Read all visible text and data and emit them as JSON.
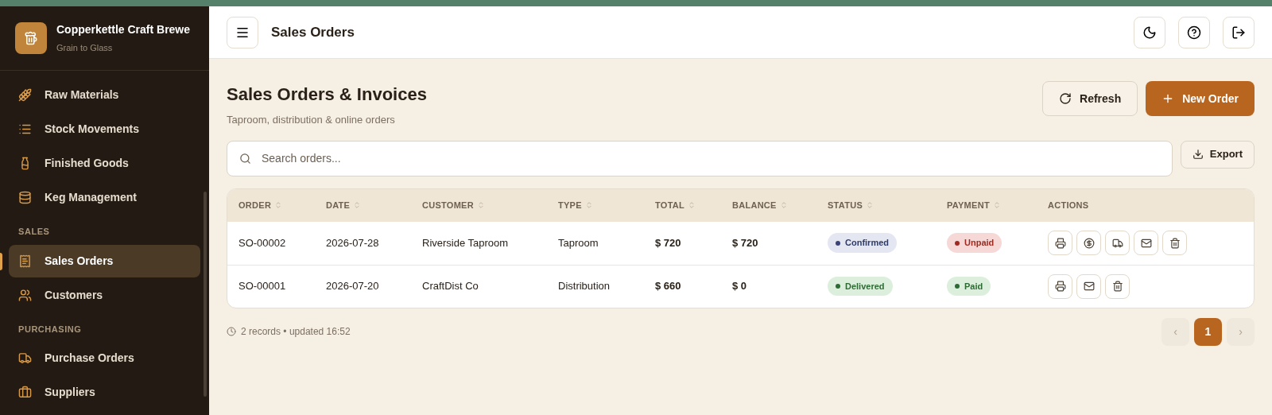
{
  "brand": {
    "name": "Copperkettle Craft Brewe",
    "tagline": "Grain to Glass"
  },
  "sidebar": {
    "groups": [
      {
        "items": [
          {
            "label": "Raw Materials",
            "kind": "wheat",
            "selected": false
          },
          {
            "label": "Stock Movements",
            "kind": "list",
            "selected": false
          },
          {
            "label": "Finished Goods",
            "kind": "bottle",
            "selected": false
          },
          {
            "label": "Keg Management",
            "kind": "keg",
            "selected": false
          }
        ]
      },
      {
        "heading": "SALES",
        "items": [
          {
            "label": "Sales Orders",
            "kind": "receipt",
            "selected": true
          },
          {
            "label": "Customers",
            "kind": "users",
            "selected": false
          }
        ]
      },
      {
        "heading": "PURCHASING",
        "items": [
          {
            "label": "Purchase Orders",
            "kind": "truck",
            "selected": false
          },
          {
            "label": "Suppliers",
            "kind": "briefcase",
            "selected": false
          }
        ]
      }
    ]
  },
  "header": {
    "title": "Sales Orders"
  },
  "page": {
    "title": "Sales Orders & Invoices",
    "subtitle": "Taproom, distribution & online orders",
    "buttons": [
      {
        "label": "Refresh",
        "kind": "refresh"
      },
      {
        "label": "New Order",
        "kind": "new"
      }
    ]
  },
  "search": {
    "placeholder": "Search orders..."
  },
  "export": {
    "label": "Export"
  },
  "table": {
    "columns": [
      {
        "label": "ORDER",
        "sortable": true
      },
      {
        "label": "DATE",
        "sortable": true
      },
      {
        "label": "CUSTOMER",
        "sortable": true
      },
      {
        "label": "TYPE",
        "sortable": true
      },
      {
        "label": "TOTAL",
        "sortable": true
      },
      {
        "label": "BALANCE",
        "sortable": true
      },
      {
        "label": "STATUS",
        "sortable": true
      },
      {
        "label": "PAYMENT",
        "sortable": true
      },
      {
        "label": "ACTIONS",
        "sortable": false
      }
    ],
    "rows": [
      {
        "order": "SO-00002",
        "date": "2026-07-28",
        "customer": "Riverside Taproom",
        "type": "Taproom",
        "total": "$ 720",
        "balance": "$ 720",
        "status": {
          "label": "Confirmed",
          "kind": "confirmed"
        },
        "payment": {
          "label": "Unpaid",
          "kind": "unpaid"
        },
        "actions": [
          {
            "kind": "print"
          },
          {
            "kind": "payment"
          },
          {
            "kind": "ship"
          },
          {
            "kind": "email"
          },
          {
            "kind": "delete"
          }
        ]
      },
      {
        "order": "SO-00001",
        "date": "2026-07-20",
        "customer": "CraftDist Co",
        "type": "Distribution",
        "total": "$ 660",
        "balance": "$ 0",
        "status": {
          "label": "Delivered",
          "kind": "delivered"
        },
        "payment": {
          "label": "Paid",
          "kind": "paid"
        },
        "actions": [
          {
            "kind": "print"
          },
          {
            "kind": "email"
          },
          {
            "kind": "delete"
          }
        ]
      }
    ]
  },
  "footer": {
    "summary": "2 records • updated 16:52"
  },
  "pagination": {
    "prev": "‹",
    "next": "›",
    "pages": [
      {
        "label": "1",
        "selected": true
      }
    ]
  }
}
